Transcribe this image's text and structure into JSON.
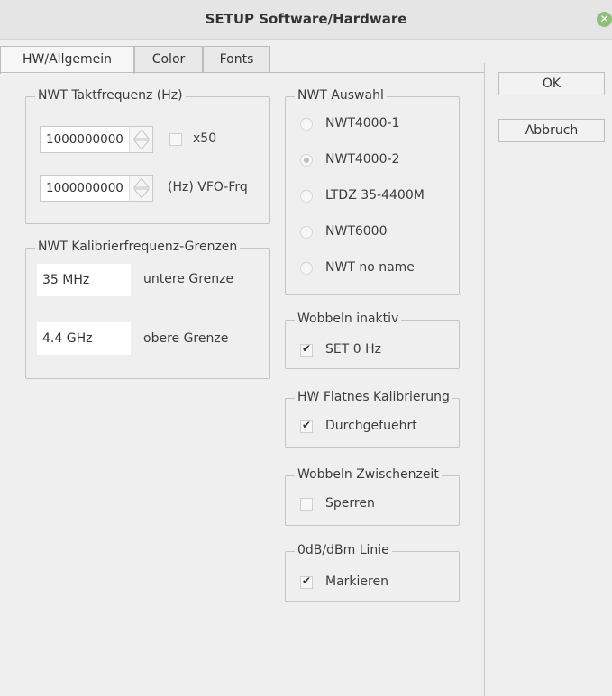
{
  "window": {
    "title": "SETUP Software/Hardware"
  },
  "tabs": [
    {
      "label": "HW/Allgemein",
      "active": true
    },
    {
      "label": "Color",
      "active": false
    },
    {
      "label": "Fonts",
      "active": false
    }
  ],
  "buttons": {
    "ok": "OK",
    "cancel": "Abbruch"
  },
  "taktfrequenz": {
    "title": "NWT Taktfrequenz (Hz)",
    "takt_value": "1000000000",
    "x50_label": "x50",
    "x50_checked": false,
    "vfo_value": "1000000000",
    "vfo_label": "(Hz)  VFO-Frq"
  },
  "kalibrier": {
    "title": "NWT Kalibrierfrequenz-Grenzen",
    "lower_value": "35 MHz",
    "lower_label": "untere Grenze",
    "upper_value": "4.4 GHz",
    "upper_label": "obere Grenze"
  },
  "auswahl": {
    "title": "NWT Auswahl",
    "options": [
      {
        "label": "NWT4000-1",
        "checked": false
      },
      {
        "label": "NWT4000-2",
        "checked": true
      },
      {
        "label": "LTDZ 35-4400M",
        "checked": false
      },
      {
        "label": "NWT6000",
        "checked": false
      },
      {
        "label": "NWT no name",
        "checked": false
      }
    ]
  },
  "wobbeln_inaktiv": {
    "title": "Wobbeln inaktiv",
    "label": "SET 0 Hz",
    "checked": true
  },
  "flatnes": {
    "title": "HW Flatnes Kalibrierung",
    "label": "Durchgefuehrt",
    "checked": true
  },
  "zwischenzeit": {
    "title": "Wobbeln Zwischenzeit",
    "label": "Sperren",
    "checked": false
  },
  "linie": {
    "title": "0dB/dBm Linie",
    "label": "Markieren",
    "checked": true
  },
  "colors": {
    "background": "#efefef",
    "close_button": "#8ec07c"
  }
}
